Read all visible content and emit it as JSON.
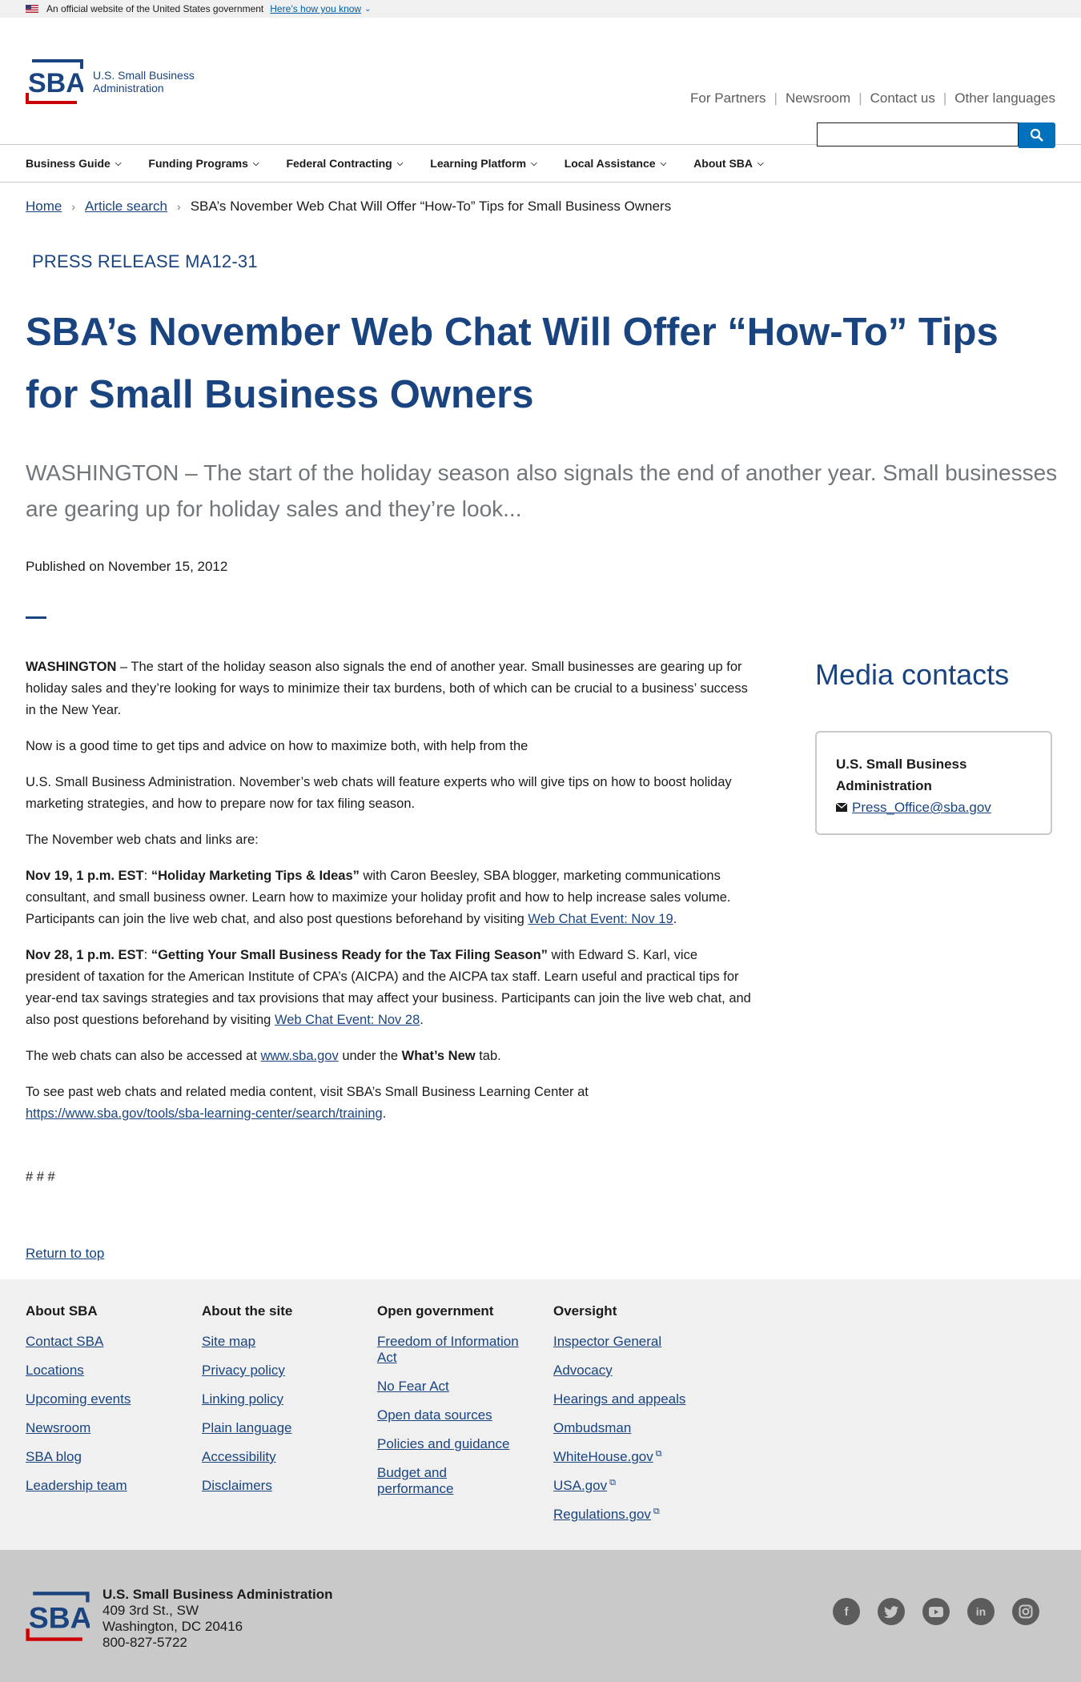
{
  "gov_banner": {
    "text": "An official website of the United States government",
    "link": "Here’s how you know"
  },
  "header": {
    "logo_line1": "U.S. Small Business",
    "logo_line2": "Administration",
    "utility_links": [
      "For Partners",
      "Newsroom",
      "Contact us",
      "Other languages"
    ],
    "search_value": ""
  },
  "nav": {
    "items": [
      "Business Guide",
      "Funding Programs",
      "Federal Contracting",
      "Learning Platform",
      "Local Assistance",
      "About SBA"
    ]
  },
  "breadcrumb": {
    "home": "Home",
    "article_search": "Article search",
    "current": "SBA’s November Web Chat Will Offer “How-To” Tips for Small Business Owners"
  },
  "article": {
    "eyebrow": "PRESS RELEASE MA12-31",
    "title": "SBA’s November Web Chat Will Offer “How-To” Tips for Small Business Owners",
    "summary": "WASHINGTON – The start of the holiday season also signals the end of another year.  Small businesses are gearing up for holiday sales and they’re look...",
    "published": "Published on November 15, 2012",
    "p1_bold": "WASHINGTON",
    "p1_rest": " – The start of the holiday season also signals the end of another year.  Small businesses are gearing up for holiday sales and they’re looking for ways to minimize their tax burdens, both of which can be crucial to a business’ success in the New Year.",
    "p2": "Now is a good time to get tips and advice on how to maximize both, with help from the",
    "p3": "U.S. Small Business Administration.  November’s web chats will feature experts who will give tips on how to boost holiday marketing strategies, and how to prepare now for tax filing season.",
    "p4": "The November web chats and links are:",
    "p5_bold1": "Nov 19, 1 p.m. EST",
    "p5_colon": ": ",
    "p5_bold2": "“Holiday Marketing Tips & Ideas”",
    "p5_text": " with Caron Beesley, SBA blogger, marketing communications consultant, and small business owner.  Learn how to maximize your holiday profit and how to help increase sales volume.  Participants can join the live web chat, and also post questions beforehand by visiting ",
    "p5_link": "Web Chat Event: Nov 19",
    "p5_end": ".",
    "p6_bold1": "Nov 28, 1 p.m. EST",
    "p6_colon": ": ",
    "p6_bold2": "“Getting Your Small Business Ready for the Tax Filing Season”",
    "p6_text": " with Edward S. Karl, vice president of taxation for the American Institute of CPA’s (AICPA) and the AICPA tax staff.  Learn useful and practical tips for year-end tax savings strategies and tax provisions that may affect your business.  Participants can join the live web chat, and also post questions beforehand by visiting ",
    "p6_link": "Web Chat Event: Nov 28",
    "p6_end": ".",
    "p7_a": "The web chats can also be accessed at ",
    "p7_link": "www.sba.gov",
    "p7_b": " under the ",
    "p7_bold": "What’s New",
    "p7_c": " tab.",
    "p8_a": "To see past web chats and related media content, visit SBA’s Small Business Learning Center at ",
    "p8_link": "https://www.sba.gov/tools/sba-learning-center/search/training",
    "p8_end": ".",
    "hashes": "# # #",
    "return_top": "Return to top"
  },
  "media": {
    "title": "Media contacts",
    "org": "U.S. Small Business Administration",
    "email": "Press_Office@sba.gov"
  },
  "footer": {
    "columns": [
      {
        "heading": "About SBA",
        "links": [
          "Contact SBA",
          "Locations",
          "Upcoming events",
          "Newsroom",
          "SBA blog",
          "Leadership team"
        ]
      },
      {
        "heading": "About the site",
        "links": [
          "Site map",
          "Privacy policy",
          "Linking policy",
          "Plain language",
          "Accessibility",
          "Disclaimers"
        ]
      },
      {
        "heading": "Open government",
        "links": [
          "Freedom of Information Act",
          "No Fear Act",
          "Open data sources",
          "Policies and guidance",
          "Budget and performance"
        ]
      },
      {
        "heading": "Oversight",
        "links": [
          "Inspector General",
          "Advocacy",
          "Hearings and appeals",
          "Ombudsman",
          "WhiteHouse.gov",
          "USA.gov",
          "Regulations.gov"
        ]
      }
    ],
    "org": "U.S. Small Business Administration",
    "address1": "409 3rd St., SW",
    "address2": "Washington, DC 20416",
    "phone": "800-827-5722",
    "social": [
      "facebook-icon",
      "twitter-icon",
      "youtube-icon",
      "linkedin-icon",
      "instagram-icon"
    ]
  },
  "colors": {
    "brand_blue": "#1a4480",
    "search_blue": "#0071bc",
    "brand_red": "#cc0000"
  }
}
